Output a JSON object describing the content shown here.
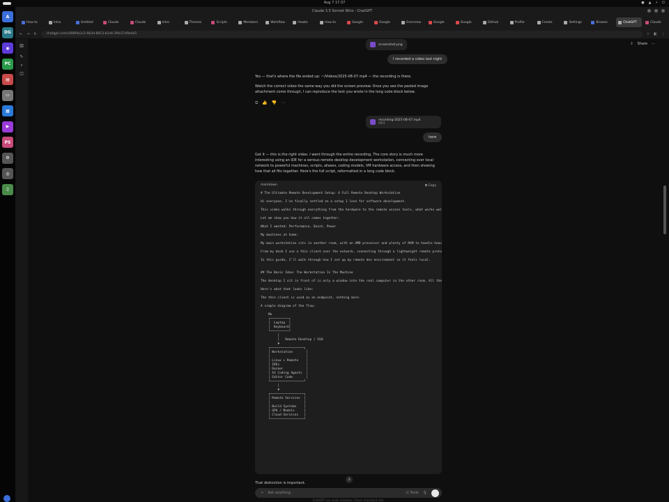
{
  "system": {
    "clock": "Aug 7 17:37",
    "tray": [
      "●",
      "▲",
      "⚡",
      "⏻"
    ]
  },
  "window": {
    "title": "Claude 3.5 Sonnet Wins - ChatGPT"
  },
  "dock": {
    "apps": [
      {
        "label": "A",
        "color": "#3b6fd9"
      },
      {
        "label": "DG",
        "color": "#2a7a8a"
      },
      {
        "label": "◉",
        "color": "#5d3bd9"
      },
      {
        "label": "PC",
        "color": "#2a9a4a"
      },
      {
        "label": "▤",
        "color": "#c84a4a"
      },
      {
        "label": "▭",
        "color": "#777"
      },
      {
        "label": "▦",
        "color": "#2a7ad9"
      },
      {
        "label": "▶",
        "color": "#9a3bd9"
      },
      {
        "label": "PS",
        "color": "#c84a7a"
      },
      {
        "label": "⚙",
        "color": "#555"
      },
      {
        "label": "◎",
        "color": "#555"
      },
      {
        "label": "▯",
        "color": "#4a8a4a"
      }
    ]
  },
  "tabs": [
    {
      "label": "How to",
      "color": "#4a6fd9"
    },
    {
      "label": "Intro",
      "color": "#aaa"
    },
    {
      "label": "Untitled",
      "color": "#4a6fd9"
    },
    {
      "label": "Claude",
      "color": "#c84a7a"
    },
    {
      "label": "Claude",
      "color": "#c84a7a"
    },
    {
      "label": "Intro",
      "color": "#aaa"
    },
    {
      "label": "Themes",
      "color": "#aaa"
    },
    {
      "label": "Scripts",
      "color": "#c84a7a"
    },
    {
      "label": "Members",
      "color": "#aaa"
    },
    {
      "label": "Workflow",
      "color": "#aaa"
    },
    {
      "label": "Howto",
      "color": "#aaa"
    },
    {
      "label": "How to",
      "color": "#aaa"
    },
    {
      "label": "Google",
      "color": "#d94a4a"
    },
    {
      "label": "Google",
      "color": "#d94a4a"
    },
    {
      "label": "Overview",
      "color": "#aaa"
    },
    {
      "label": "Google",
      "color": "#d94a4a"
    },
    {
      "label": "Google",
      "color": "#d94a4a"
    },
    {
      "label": "GitHub",
      "color": "#aaa"
    },
    {
      "label": "Profile",
      "color": "#aaa"
    },
    {
      "label": "Create",
      "color": "#aaa"
    },
    {
      "label": "Settings",
      "color": "#aaa"
    },
    {
      "label": "Browse",
      "color": "#4a6fd9"
    },
    {
      "label": "ChatGPT",
      "color": "#aaa",
      "active": true
    },
    {
      "label": "Claude",
      "color": "#c84a7a"
    }
  ],
  "nav": {
    "url": "chatgpt.com/c/6894a1c2-0b3d-8013-b1e6-3f0c27d9e4a5",
    "back": "←",
    "forward": "→",
    "reload": "↻"
  },
  "chat": {
    "share": "Share",
    "file_chip_top": "screenshot.png",
    "user_msg_1": "I recorded a video last night",
    "assistant_1a": "Yes — that's where the file ended up: ~/Videos/2025-08-07.mp4 — the recording is there.",
    "assistant_1b": "Watch the correct video the same way you did the screen preview. Once you see the pasted image attachment come through, I can reproduce the text you wrote in the long code block below.",
    "file_chip_2": "recording-2025-08-07.mp4",
    "file_chip_2_sub": "MP4",
    "user_msg_2": "here",
    "assistant_2": "Got it — this is the right video. I went through the entire recording. The core story is much more interesting using an IDE for a serious remote desktop development workstation, connecting over local network to powerful machines, scripts, aliases, coding models, VM hardware access, and then showing how that all fits together. Here's the full script, reformatted in a long code block.",
    "code_lang": "markdown",
    "code_copy": "Copy",
    "code_lines": [
      "# The Ultimate Remote Development Setup: A Full Remote Desktop Workstation",
      "",
      "Hi everyone, I've finally settled on a setup I love for software development.",
      "",
      "This video walks through everything from the hardware to the remote access tools, what works well and what doesn't.",
      "",
      "Let me show you how it all comes together.",
      "",
      "What I wanted: Performance, Quiet, Power",
      "",
      "My machines at home:",
      "",
      "My main workstation sits in another room, with an AMD processor and plenty of RAM to handle heavy workloads.",
      "",
      "From my desk I use a thin client over the network, connecting through a lightweight remote protocol.",
      "",
      "In this guide, I'll walk through how I set up my remote dev environment so it feels local.",
      "",
      "",
      "## The Basic Idea: The Workstation Is The Machine",
      "",
      "The desktop I sit in front of is only a window into the real computer in the other room. All the heavy work runs there.",
      "",
      "Here's what that looks like:",
      "",
      "The thin client is used as an endpoint, nothing more.",
      "",
      "A simple diagram of the flow:",
      "",
      "    Me",
      "    ┌──────────┐",
      "    │  Laptop  │",
      "    │  Keyboard│",
      "    └──────────┘",
      "         │",
      "         │   Remote Desktop / SSH",
      "         ▼",
      "    ┌──────────────────┐",
      "    │ Workstation       │",
      "    │                   │",
      "    │ Linux + Remote    │",
      "    │ IDEs              │",
      "    │ Docker            │",
      "    │ AI Coding Agents  │",
      "    │ Editor Code       │",
      "    └──────────────────┘",
      "         │",
      "         ▼",
      "    ┌──────────────────┐",
      "    │ Remote Services  │",
      "    │                  │",
      "    │ Build Systems    │",
      "    │ GPU / Models     │",
      "    │ Cloud Services   │",
      "    └──────────────────┘"
    ],
    "after_code": "That distinction is important.",
    "composer_placeholder": "Ask anything",
    "composer_tools": "Tools",
    "disclaimer": "ChatGPT can make mistakes. Check important info."
  }
}
